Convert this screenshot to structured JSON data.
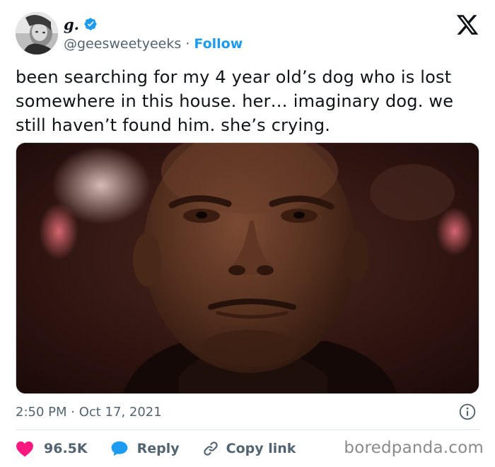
{
  "author": {
    "display_name": "g.",
    "handle": "@geesweetyeeks",
    "separator": "·",
    "follow_label": "Follow",
    "verified": true
  },
  "tweet": {
    "text": "been searching for my 4 year old’s dog who is lost\nsomewhere in this house. her… imaginary dog. we\nstill haven’t found him. she’s crying.",
    "timestamp": "2:50 PM · Oct 17, 2021"
  },
  "actions": {
    "likes_count": "96.5K",
    "reply_label": "Reply",
    "copy_link_label": "Copy link"
  },
  "watermark": "boredpanda.com",
  "icons": {
    "platform": "x-logo-icon",
    "verified": "verified-badge-icon",
    "info": "info-icon",
    "like": "heart-icon",
    "reply": "speech-bubble-icon",
    "copy": "link-icon"
  },
  "colors": {
    "accent": "#1d9bf0",
    "like": "#f91880",
    "secondary_text": "#536471",
    "text": "#0f1419",
    "watermark": "#8a8a8a"
  }
}
